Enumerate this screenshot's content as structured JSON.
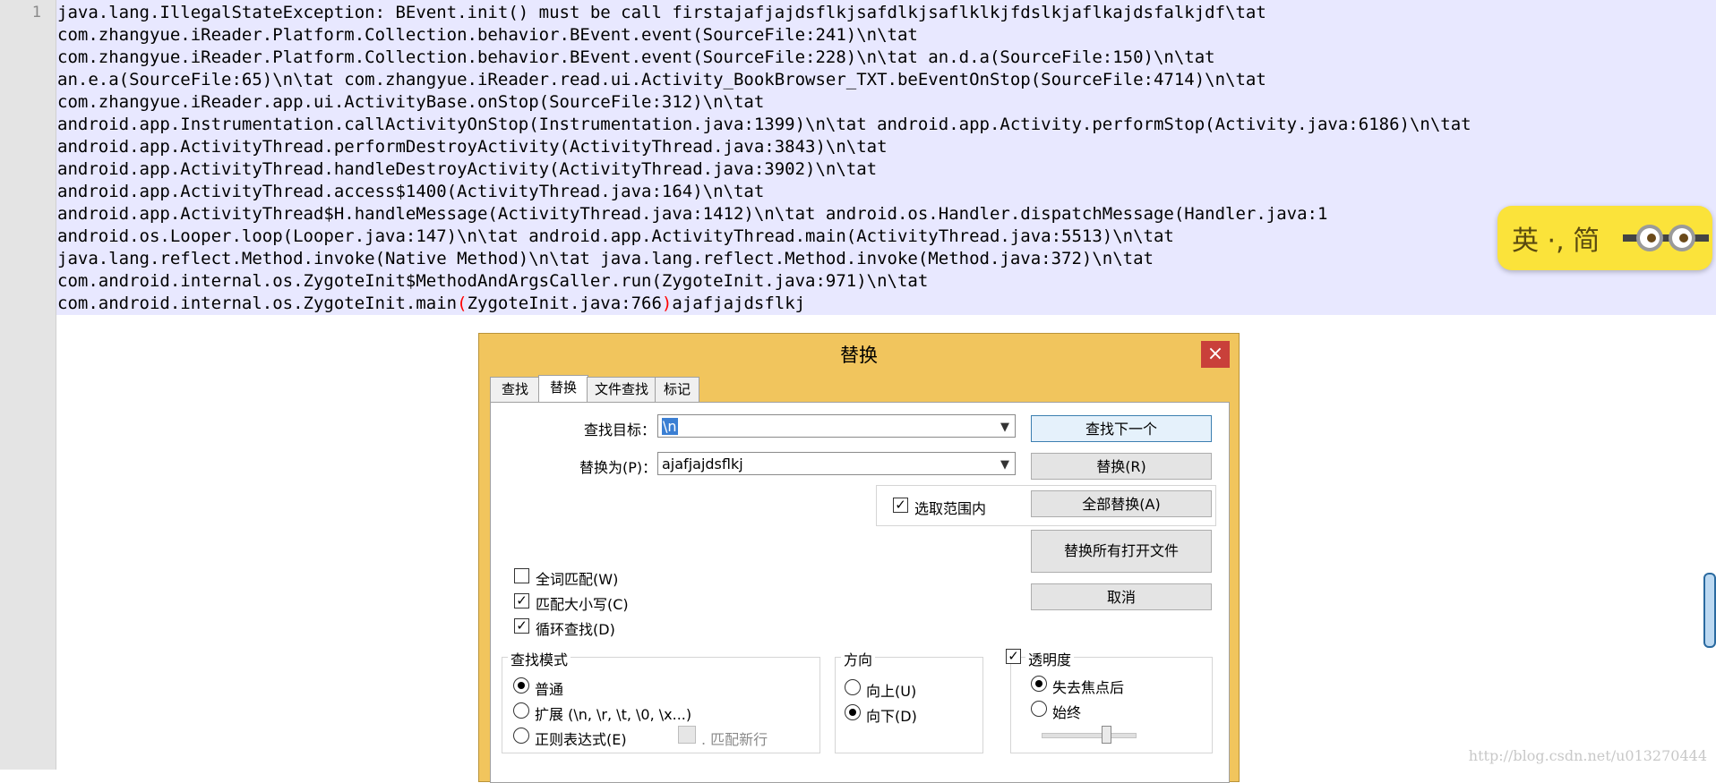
{
  "editor": {
    "line_number": "1",
    "lines": [
      "java.lang.IllegalStateException: BEvent.init() must be call firstajafjajdsflkjsafdlkjsaflklkjfdslkjaflkajdsfalkjdf\\tat",
      "com.zhangyue.iReader.Platform.Collection.behavior.BEvent.event(SourceFile:241)\\n\\tat",
      "com.zhangyue.iReader.Platform.Collection.behavior.BEvent.event(SourceFile:228)\\n\\tat an.d.a(SourceFile:150)\\n\\tat",
      "an.e.a(SourceFile:65)\\n\\tat com.zhangyue.iReader.read.ui.Activity_BookBrowser_TXT.beEventOnStop(SourceFile:4714)\\n\\tat",
      "com.zhangyue.iReader.app.ui.ActivityBase.onStop(SourceFile:312)\\n\\tat",
      "android.app.Instrumentation.callActivityOnStop(Instrumentation.java:1399)\\n\\tat android.app.Activity.performStop(Activity.java:6186)\\n\\tat",
      "android.app.ActivityThread.performDestroyActivity(ActivityThread.java:3843)\\n\\tat",
      "android.app.ActivityThread.handleDestroyActivity(ActivityThread.java:3902)\\n\\tat",
      "android.app.ActivityThread.access$1400(ActivityThread.java:164)\\n\\tat",
      "android.app.ActivityThread$H.handleMessage(ActivityThread.java:1412)\\n\\tat android.os.Handler.dispatchMessage(Handler.java:1",
      "android.os.Looper.loop(Looper.java:147)\\n\\tat android.app.ActivityThread.main(ActivityThread.java:5513)\\n\\tat",
      "java.lang.reflect.Method.invoke(Native Method)\\n\\tat java.lang.reflect.Method.invoke(Method.java:372)\\n\\tat",
      "com.android.internal.os.ZygoteInit$MethodAndArgsCaller.run(ZygoteInit.java:971)\\n\\tat"
    ],
    "last_line_prefix": "com.android.internal.os.ZygoteInit.main",
    "last_line_open_paren": "(",
    "last_line_middle": "ZygoteInit.java:766",
    "last_line_close_paren": ")",
    "last_line_suffix": "ajafjajdsflkj"
  },
  "ime": {
    "text": "英 ·, 简"
  },
  "watermark": "http://blog.csdn.net/u013270444",
  "dialog": {
    "title": "替换",
    "close": "×",
    "tabs": [
      "查找",
      "替换",
      "文件查找",
      "标记"
    ],
    "active_tab": "替换",
    "find_label": "查找目标：",
    "find_value": "\\n",
    "replace_label": "替换为(P)：",
    "replace_value": "ajafjajdsflkj",
    "in_selection_label": "选取范围内",
    "in_selection_checked": true,
    "buttons": {
      "find_next": "查找下一个",
      "replace": "替换(R)",
      "replace_all": "全部替换(A)",
      "replace_all_open": "替换所有打开文件",
      "cancel": "取消"
    },
    "options": [
      {
        "label": "全词匹配(W)",
        "checked": false
      },
      {
        "label": "匹配大小写(C)",
        "checked": true
      },
      {
        "label": "循环查找(D)",
        "checked": true
      }
    ],
    "search_mode": {
      "title": "查找模式",
      "items": [
        "普通",
        "扩展 (\\n, \\r, \\t, \\0, \\x...)",
        "正则表达式(E)"
      ],
      "selected": "普通",
      "dot_newline_label": ". 匹配新行",
      "dot_newline_checked": false
    },
    "direction": {
      "title": "方向",
      "items": [
        "向上(U)",
        "向下(D)"
      ],
      "selected": "向下(D)"
    },
    "transparency": {
      "title": "透明度",
      "checked": true,
      "items": [
        "失去焦点后",
        "始终"
      ],
      "selected": "失去焦点后",
      "level": 0.7
    }
  }
}
